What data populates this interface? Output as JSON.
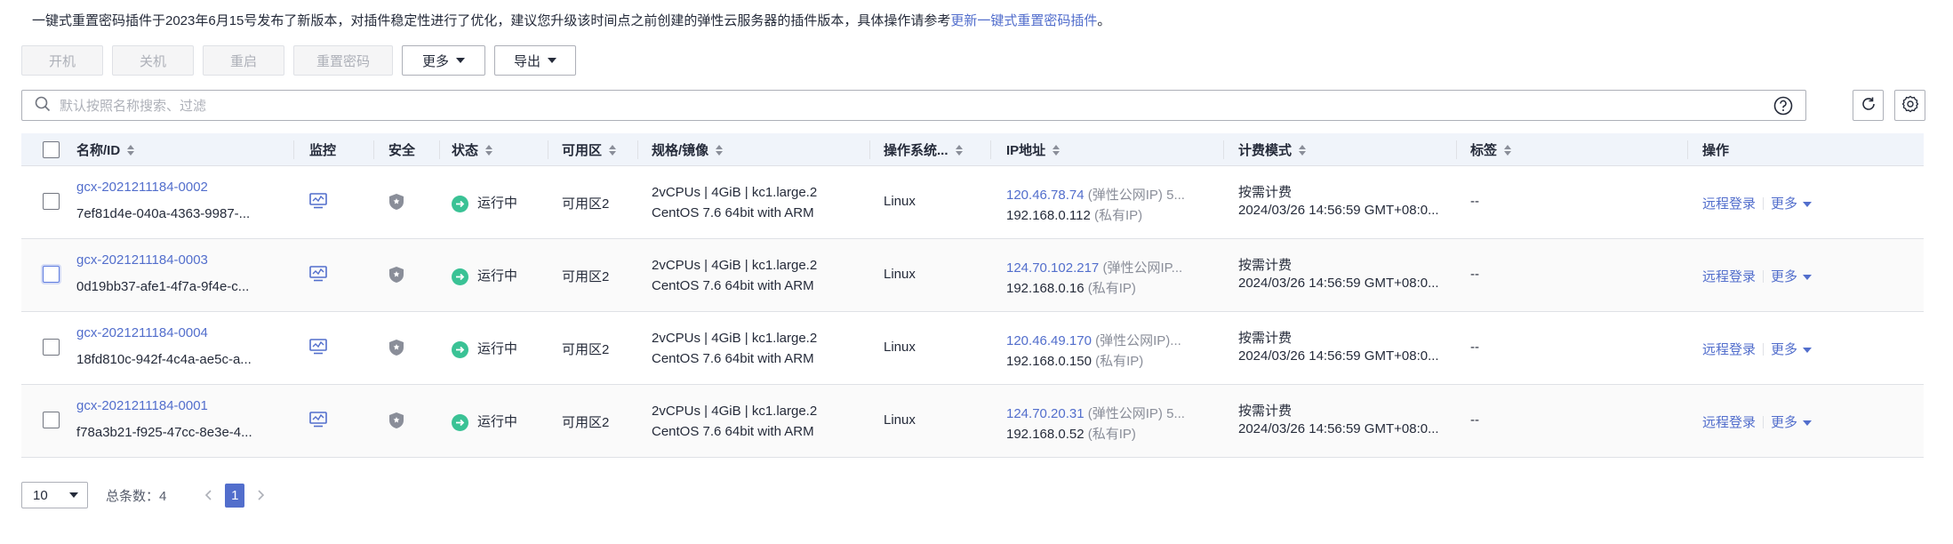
{
  "notice": {
    "text": "一键式重置密码插件于2023年6月15号发布了新版本，对插件稳定性进行了优化，建议您升级该时间点之前创建的弹性云服务器的插件版本，具体操作请参考",
    "link": "更新一键式重置密码插件",
    "suffix": "。"
  },
  "toolbar": {
    "start": "开机",
    "stop": "关机",
    "restart": "重启",
    "reset_password": "重置密码",
    "more": "更多",
    "export": "导出"
  },
  "search": {
    "placeholder": "默认按照名称搜索、过滤"
  },
  "columns": {
    "name": "名称/ID",
    "monitor": "监控",
    "security": "安全",
    "status": "状态",
    "az": "可用区",
    "spec": "规格/镜像",
    "os": "操作系统...",
    "ip": "IP地址",
    "billing": "计费模式",
    "tags": "标签",
    "ops": "操作"
  },
  "rows": [
    {
      "name": "gcx-2021211184-0002",
      "id": "7ef81d4e-040a-4363-9987-...",
      "status": "运行中",
      "az": "可用区2",
      "spec": "2vCPUs | 4GiB | kc1.large.2",
      "image": "CentOS 7.6 64bit with ARM",
      "os": "Linux",
      "public_ip": "120.46.78.74",
      "public_ip_label": "(弹性公网IP) 5...",
      "private_ip": "192.168.0.112",
      "private_ip_label": "(私有IP)",
      "billing": "按需计费",
      "created": "2024/03/26 14:56:59 GMT+08:0...",
      "tags": "--",
      "remote_login": "远程登录",
      "more": "更多"
    },
    {
      "name": "gcx-2021211184-0003",
      "id": "0d19bb37-afe1-4f7a-9f4e-c...",
      "status": "运行中",
      "az": "可用区2",
      "spec": "2vCPUs | 4GiB | kc1.large.2",
      "image": "CentOS 7.6 64bit with ARM",
      "os": "Linux",
      "public_ip": "124.70.102.217",
      "public_ip_label": "(弹性公网IP...",
      "private_ip": "192.168.0.16",
      "private_ip_label": "(私有IP)",
      "billing": "按需计费",
      "created": "2024/03/26 14:56:59 GMT+08:0...",
      "tags": "--",
      "remote_login": "远程登录",
      "more": "更多"
    },
    {
      "name": "gcx-2021211184-0004",
      "id": "18fd810c-942f-4c4a-ae5c-a...",
      "status": "运行中",
      "az": "可用区2",
      "spec": "2vCPUs | 4GiB | kc1.large.2",
      "image": "CentOS 7.6 64bit with ARM",
      "os": "Linux",
      "public_ip": "120.46.49.170",
      "public_ip_label": "(弹性公网IP)...",
      "private_ip": "192.168.0.150",
      "private_ip_label": "(私有IP)",
      "billing": "按需计费",
      "created": "2024/03/26 14:56:59 GMT+08:0...",
      "tags": "--",
      "remote_login": "远程登录",
      "more": "更多"
    },
    {
      "name": "gcx-2021211184-0001",
      "id": "f78a3b21-f925-47cc-8e3e-4...",
      "status": "运行中",
      "az": "可用区2",
      "spec": "2vCPUs | 4GiB | kc1.large.2",
      "image": "CentOS 7.6 64bit with ARM",
      "os": "Linux",
      "public_ip": "124.70.20.31",
      "public_ip_label": "(弹性公网IP) 5...",
      "private_ip": "192.168.0.52",
      "private_ip_label": "(私有IP)",
      "billing": "按需计费",
      "created": "2024/03/26 14:56:59 GMT+08:0...",
      "tags": "--",
      "remote_login": "远程登录",
      "more": "更多"
    }
  ],
  "pagination": {
    "page_size": "10",
    "total_label": "总条数：4",
    "current_page": "1"
  },
  "icons": {
    "monitor": "monitor-chart-icon",
    "security": "shield-icon",
    "status": "running-arrow-icon"
  },
  "colors": {
    "link": "#526ecc",
    "running": "#3ac295",
    "header_bg": "#f0f4fa"
  }
}
